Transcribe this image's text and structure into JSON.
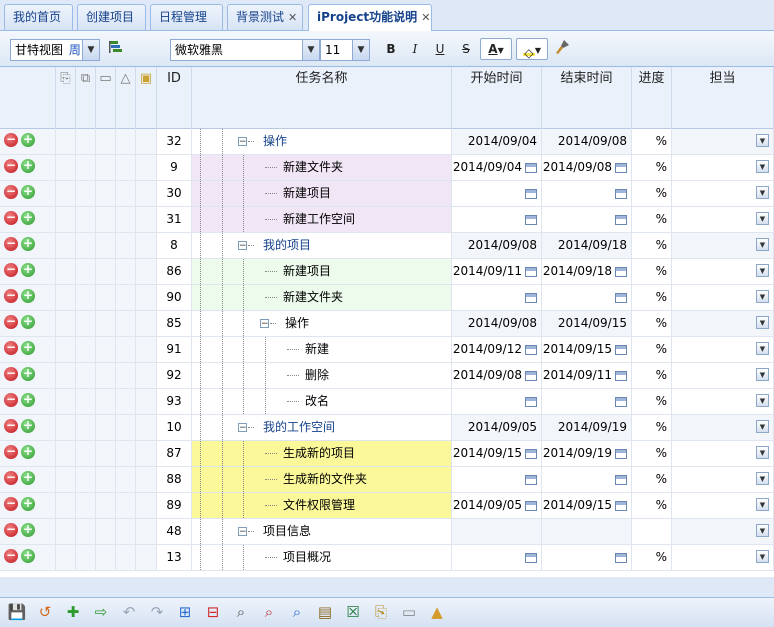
{
  "tabs": [
    {
      "label": "我的首页",
      "closable": false,
      "active": false
    },
    {
      "label": "创建项目",
      "closable": false,
      "active": false
    },
    {
      "label": "日程管理",
      "closable": false,
      "active": false
    },
    {
      "label": "背景测试",
      "closable": true,
      "active": false
    },
    {
      "label": "iProject功能说明",
      "closable": true,
      "active": true
    }
  ],
  "toolbar": {
    "view_label": "甘特视图",
    "view_unit": "周",
    "font_family": "微软雅黑",
    "font_size": "11",
    "bold": "B",
    "italic": "I",
    "underline": "U",
    "strike": "S",
    "font_color": "A"
  },
  "columns": {
    "id": "ID",
    "name": "任务名称",
    "start": "开始时间",
    "end": "结束时间",
    "progress": "进度",
    "owner": "担当"
  },
  "colors": {
    "purple": "#f1e6f6",
    "green": "#ecfbec",
    "yellow": "#fbf89a",
    "group_text": "#15428b"
  },
  "rows": [
    {
      "id": "32",
      "name": "操作",
      "level": 1,
      "group": true,
      "start": "2014/09/04",
      "end": "2014/09/08",
      "progress": "%",
      "bg": "",
      "cal": false
    },
    {
      "id": "9",
      "name": "新建文件夹",
      "level": 2,
      "group": false,
      "start": "2014/09/04",
      "end": "2014/09/08",
      "progress": "%",
      "bg": "purple",
      "cal": true
    },
    {
      "id": "30",
      "name": "新建项目",
      "level": 2,
      "group": false,
      "start": "",
      "end": "",
      "progress": "%",
      "bg": "purple",
      "cal": true
    },
    {
      "id": "31",
      "name": "新建工作空间",
      "level": 2,
      "group": false,
      "start": "",
      "end": "",
      "progress": "%",
      "bg": "purple",
      "cal": true
    },
    {
      "id": "8",
      "name": "我的项目",
      "level": 1,
      "group": true,
      "start": "2014/09/08",
      "end": "2014/09/18",
      "progress": "%",
      "bg": "",
      "cal": false
    },
    {
      "id": "86",
      "name": "新建项目",
      "level": 2,
      "group": false,
      "start": "2014/09/11",
      "end": "2014/09/18",
      "progress": "%",
      "bg": "green",
      "cal": true
    },
    {
      "id": "90",
      "name": "新建文件夹",
      "level": 2,
      "group": false,
      "start": "",
      "end": "",
      "progress": "%",
      "bg": "green",
      "cal": true
    },
    {
      "id": "85",
      "name": "操作",
      "level": 2,
      "group": true,
      "plain": true,
      "start": "2014/09/08",
      "end": "2014/09/15",
      "progress": "%",
      "bg": "",
      "cal": false
    },
    {
      "id": "91",
      "name": "新建",
      "level": 3,
      "group": false,
      "start": "2014/09/12",
      "end": "2014/09/15",
      "progress": "%",
      "bg": "",
      "cal": true
    },
    {
      "id": "92",
      "name": "删除",
      "level": 3,
      "group": false,
      "start": "2014/09/08",
      "end": "2014/09/11",
      "progress": "%",
      "bg": "",
      "cal": true
    },
    {
      "id": "93",
      "name": "改名",
      "level": 3,
      "group": false,
      "start": "",
      "end": "",
      "progress": "%",
      "bg": "",
      "cal": true
    },
    {
      "id": "10",
      "name": "我的工作空间",
      "level": 1,
      "group": true,
      "start": "2014/09/05",
      "end": "2014/09/19",
      "progress": "%",
      "bg": "",
      "cal": false
    },
    {
      "id": "87",
      "name": "生成新的项目",
      "level": 2,
      "group": false,
      "start": "2014/09/15",
      "end": "2014/09/19",
      "progress": "%",
      "bg": "yellow",
      "cal": true
    },
    {
      "id": "88",
      "name": "生成新的文件夹",
      "level": 2,
      "group": false,
      "start": "",
      "end": "",
      "progress": "%",
      "bg": "yellow",
      "cal": true
    },
    {
      "id": "89",
      "name": "文件权限管理",
      "level": 2,
      "group": false,
      "start": "2014/09/05",
      "end": "2014/09/15",
      "progress": "%",
      "bg": "yellow",
      "cal": true
    },
    {
      "id": "48",
      "name": "项目信息",
      "level": 1,
      "group": true,
      "plain": true,
      "start": "",
      "end": "",
      "progress": "",
      "bg": "",
      "cal": false
    },
    {
      "id": "13",
      "name": "项目概况",
      "level": 2,
      "group": false,
      "start": "",
      "end": "",
      "progress": "%",
      "bg": "",
      "cal": true
    }
  ],
  "bottom_icons": [
    "save-icon",
    "undo-icon",
    "add-icon",
    "indent-icon",
    "redo-back-icon",
    "redo-icon",
    "insert-icon",
    "remove-icon",
    "zoom-icon",
    "zoom-out-icon",
    "zoom-in-icon",
    "note-icon",
    "excel-icon",
    "attach-icon",
    "comment-icon",
    "bell-icon"
  ]
}
